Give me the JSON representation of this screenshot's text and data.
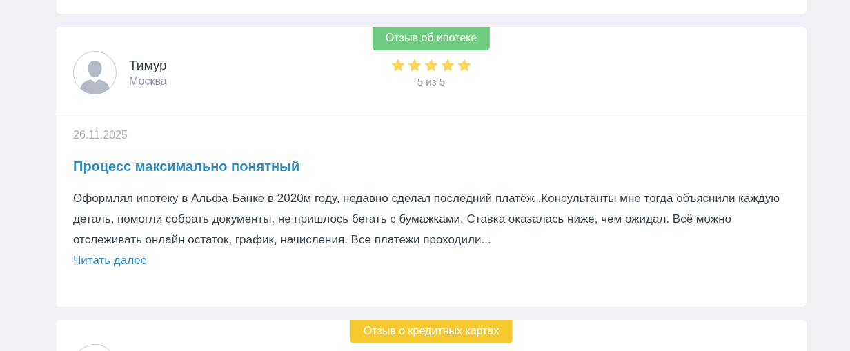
{
  "reviews": [
    {
      "tag": "Отзыв об ипотеке",
      "color": "#6fcb7d",
      "author": "Тимур",
      "city": "Москва",
      "stars": 5,
      "rating": "5 из 5",
      "date": "26.11.2025",
      "title": "Процесс максимально понятный",
      "text": "Оформлял ипотеку в Альфа-Банке в 2020м году, недавно сделал последний платёж .Консультанты мне тогда объяснили каждую деталь, помогли собрать документы, не пришлось бегать с бумажками. Ставка оказалась ниже, чем ожидал. Всё можно отслеживать онлайн остаток, график, начисления. Все платежи проходили...",
      "read_more": "Читать далее"
    },
    {
      "tag": "Отзыв о кредитных картах",
      "color": "#f6c930"
    }
  ]
}
